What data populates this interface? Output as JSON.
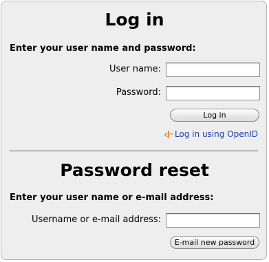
{
  "login": {
    "title": "Log in",
    "instruction": "Enter your user name and password:",
    "username_label": "User name:",
    "username_value": "",
    "password_label": "Password:",
    "password_value": "",
    "login_button": "Log in",
    "openid_link": "Log in using OpenID",
    "openid_icon": "openid-icon"
  },
  "reset": {
    "title": "Password reset",
    "instruction": "Enter your user name or e-mail address:",
    "identifier_label": "Username or e-mail address:",
    "identifier_value": "",
    "email_button": "E-mail new password"
  },
  "colors": {
    "panel_background": "#eeeeee",
    "link": "#1c3fa6",
    "openid_orange": "#f7931e"
  }
}
